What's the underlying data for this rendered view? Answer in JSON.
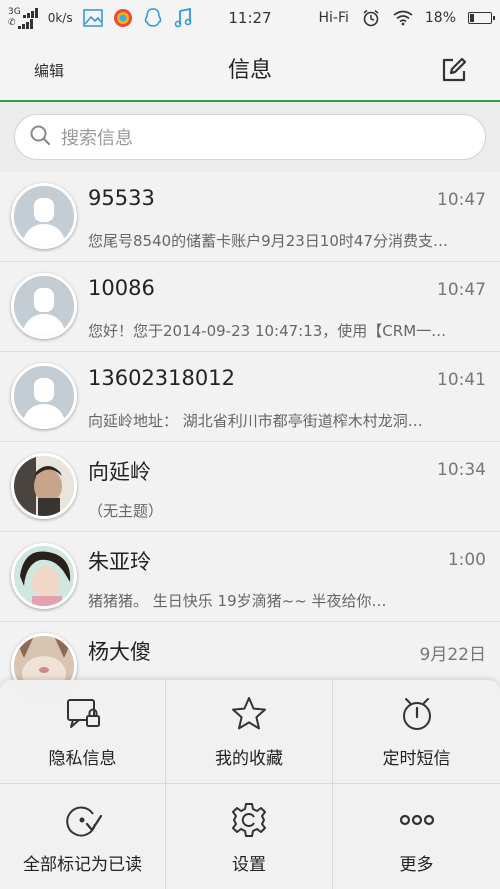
{
  "status_bar": {
    "network": "3G",
    "speed": "0k/s",
    "time": "11:27",
    "hifi": "Hi-Fi",
    "battery": "18%"
  },
  "header": {
    "edit_label": "编辑",
    "title": "信息",
    "compose_icon": "compose-icon"
  },
  "search": {
    "placeholder": "搜索信息"
  },
  "conversations": [
    {
      "name": "95533",
      "time": "10:47",
      "preview": "您尾号8540的储蓄卡账户9月23日10时47分消费支…",
      "avatar": "default"
    },
    {
      "name": "10086",
      "time": "10:47",
      "preview": "您好！您于2014-09-23 10:47:13，使用【CRM一…",
      "avatar": "default"
    },
    {
      "name": "13602318012",
      "time": "10:41",
      "preview": "  向延岭地址：    湖北省利川市都亭街道榨木村龙洞…",
      "avatar": "default"
    },
    {
      "name": "向延岭",
      "time": "10:34",
      "preview": "（无主题）",
      "avatar": "photo"
    },
    {
      "name": "朱亚玲",
      "time": "1:00",
      "preview": "  猪猪猪。   生日快乐    19岁滴猪~~        半夜给你…",
      "avatar": "photo"
    },
    {
      "name": "杨大傻",
      "time": "9月22日",
      "preview": "",
      "avatar": "photo"
    }
  ],
  "menu": {
    "items": [
      {
        "label": "隐私信息",
        "icon": "private-message-icon"
      },
      {
        "label": "我的收藏",
        "icon": "star-icon"
      },
      {
        "label": "定时短信",
        "icon": "timer-icon"
      },
      {
        "label": "全部标记为已读",
        "icon": "mark-read-icon"
      },
      {
        "label": "设置",
        "icon": "gear-icon"
      },
      {
        "label": "更多",
        "icon": "more-icon"
      }
    ]
  },
  "colors": {
    "accent": "#2fa24a",
    "background": "#f2f2f2"
  }
}
